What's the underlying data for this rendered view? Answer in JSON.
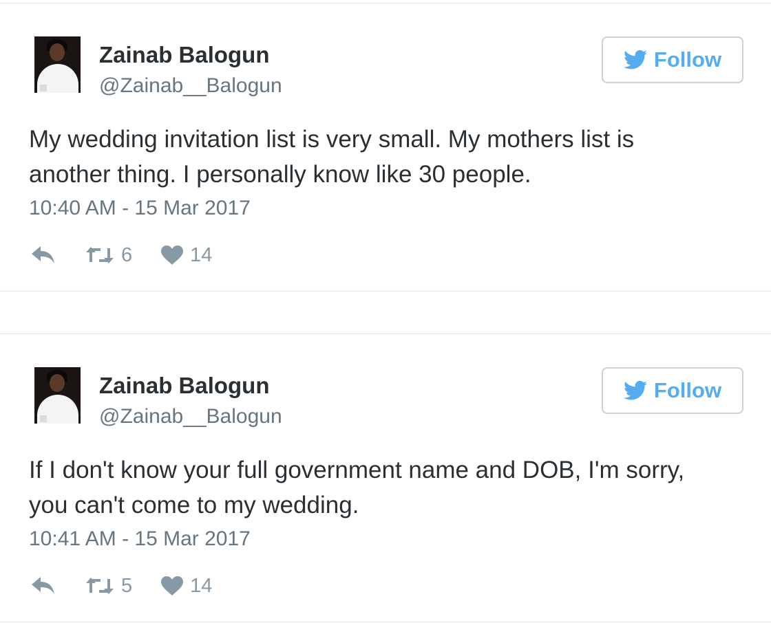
{
  "tweets": [
    {
      "author": {
        "name": "Zainab Balogun",
        "handle": "@Zainab__Balogun"
      },
      "follow_label": "Follow",
      "lines": [
        "My wedding invitation list is very small. My mothers list is",
        "another thing. I personally know like 30 people."
      ],
      "timestamp": "10:40 AM - 15 Mar 2017",
      "retweets": "6",
      "likes": "14"
    },
    {
      "author": {
        "name": "Zainab Balogun",
        "handle": "@Zainab__Balogun"
      },
      "follow_label": "Follow",
      "lines": [
        "If I don't know your full government name and DOB, I'm sorry,",
        "you can't come to my wedding."
      ],
      "timestamp": "10:41 AM - 15 Mar 2017",
      "retweets": "5",
      "likes": "14"
    }
  ],
  "icons": {
    "follow": "twitter-bird-icon",
    "reply": "reply-icon",
    "retweet": "retweet-icon",
    "like": "heart-icon"
  },
  "colors": {
    "brand": "#55acee",
    "text": "#292f33",
    "secondary": "#66757f",
    "action": "#8899a6",
    "border": "#e1e8ed"
  }
}
